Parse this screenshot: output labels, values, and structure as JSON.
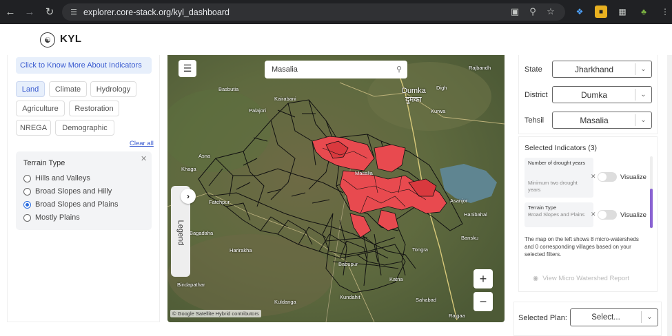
{
  "browser": {
    "url": "explorer.core-stack.org/kyl_dashboard"
  },
  "app": {
    "name": "KYL"
  },
  "left_panel": {
    "know_more": "Click to Know More About Indicators",
    "categories": [
      "Land",
      "Climate",
      "Hydrology",
      "Agriculture",
      "Restoration",
      "NREGA",
      "Demographic"
    ],
    "active_category": "Land",
    "clear_all": "Clear all",
    "terrain": {
      "title": "Terrain Type",
      "options": [
        "Hills and Valleys",
        "Broad Slopes and Hilly",
        "Broad Slopes and Plains",
        "Mostly Plains"
      ],
      "selected": "Broad Slopes and Plains"
    }
  },
  "map": {
    "search_value": "Masalia",
    "legend_label": "Legend",
    "attribution": "© Google Satellite Hybrid contributors",
    "colors": {
      "highlight": "#e84a4f",
      "boundary": "#111111"
    },
    "place_labels": [
      {
        "text": "Dumka",
        "big": true
      },
      {
        "text": "दुमका",
        "big": true
      },
      {
        "text": "Rajbandh"
      },
      {
        "text": "Digh"
      },
      {
        "text": "Basbutia"
      },
      {
        "text": "Kairabani"
      },
      {
        "text": "Palajori"
      },
      {
        "text": "Kurwa"
      },
      {
        "text": "Asna"
      },
      {
        "text": "Khaga"
      },
      {
        "text": "Fatehpur"
      },
      {
        "text": "Bagadaha"
      },
      {
        "text": "Harirakha"
      },
      {
        "text": "Babupur"
      },
      {
        "text": "Katna"
      },
      {
        "text": "Bindapathar"
      },
      {
        "text": "Kuldanga"
      },
      {
        "text": "Kundahit"
      },
      {
        "text": "Sahabad"
      },
      {
        "text": "Rajgaa"
      },
      {
        "text": "Bansku"
      },
      {
        "text": "Tongra"
      },
      {
        "text": "Masalia"
      },
      {
        "text": "Asanjor"
      },
      {
        "text": "Hanibahal"
      }
    ]
  },
  "right_panel": {
    "state_label": "State",
    "state_value": "Jharkhand",
    "district_label": "District",
    "district_value": "Dumka",
    "tehsil_label": "Tehsil",
    "tehsil_value": "Masalia",
    "selected_title": "Selected Indicators (3)",
    "indicators": [
      {
        "name": "Number of drought years",
        "detail": "Minimum two drought years",
        "visualize": "Visualize"
      },
      {
        "name": "Terrain Type",
        "detail": "Broad Slopes and Plains",
        "visualize": "Visualize"
      }
    ],
    "summary": "The map on the left shows 8 micro-watersheds and 0 corresponding villages based on your selected filters.",
    "view_report": "View Micro Watershed Report",
    "plan_label": "Selected Plan:",
    "plan_value": "Select..."
  }
}
